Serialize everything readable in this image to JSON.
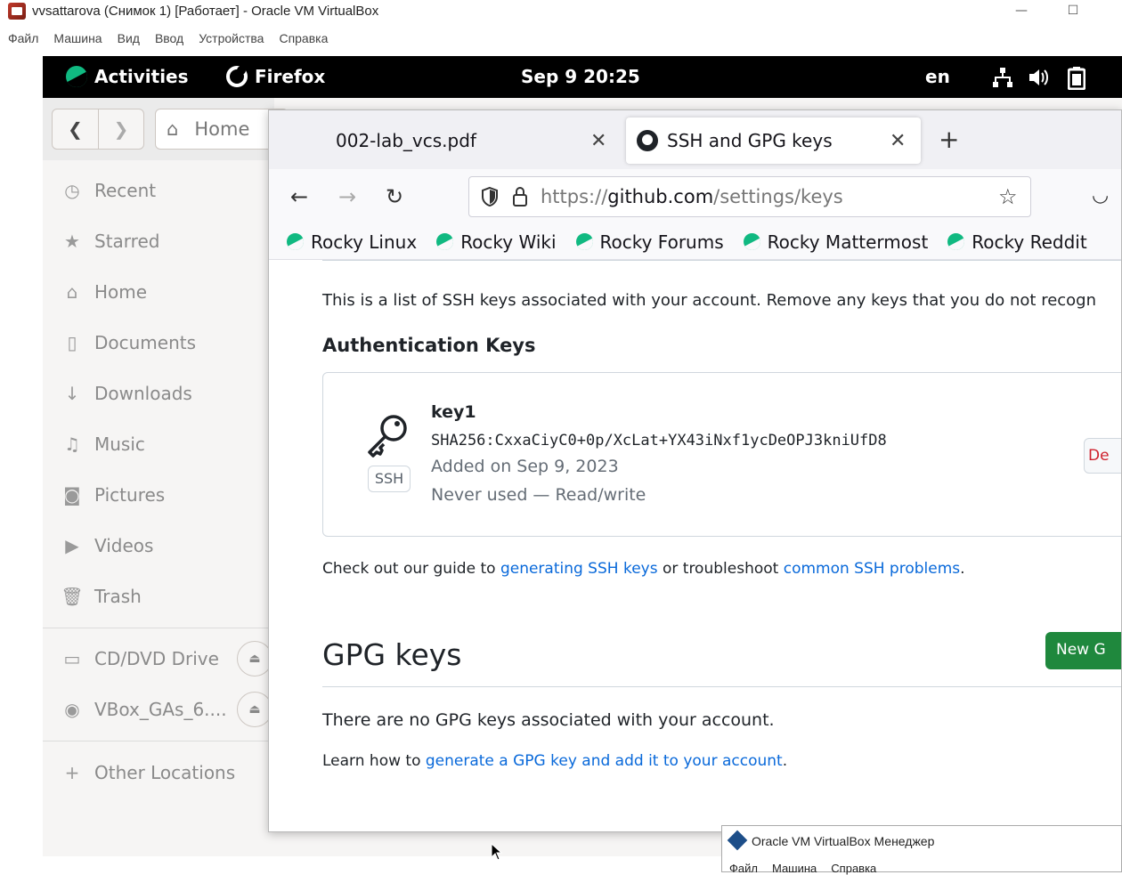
{
  "host": {
    "title": "vvsattarova (Снимок 1) [Работает] - Oracle VM VirtualBox",
    "menu": [
      "Файл",
      "Машина",
      "Вид",
      "Ввод",
      "Устройства",
      "Справка"
    ]
  },
  "topbar": {
    "activities": "Activities",
    "app": "Firefox",
    "clock": "Sep 9  20:25",
    "lang": "en"
  },
  "files": {
    "path_home": "Home",
    "sidebar": [
      "Recent",
      "Starred",
      "Home",
      "Documents",
      "Downloads",
      "Music",
      "Pictures",
      "Videos",
      "Trash"
    ],
    "devices": [
      "CD/DVD Drive",
      "VBox_GAs_6...."
    ],
    "other": "Other Locations"
  },
  "firefox": {
    "tabs": [
      {
        "label": "002-lab_vcs.pdf"
      },
      {
        "label": "SSH and GPG keys"
      }
    ],
    "url_prefix": "https://",
    "url_host": "github.com",
    "url_path": "/settings/keys",
    "bookmarks": [
      "Rocky Linux",
      "Rocky Wiki",
      "Rocky Forums",
      "Rocky Mattermost",
      "Rocky Reddit"
    ]
  },
  "page": {
    "intro": "This is a list of SSH keys associated with your account. Remove any keys that you do not recogn",
    "auth_heading": "Authentication Keys",
    "key": {
      "title": "key1",
      "fingerprint": "SHA256:CxxaCiyC0+0p/XcLat+YX43iNxf1ycDeOPJ3kniUfD8",
      "added": "Added on Sep 9, 2023",
      "used": "Never used — Read/write",
      "badge": "SSH",
      "delete": "De"
    },
    "guide_pre": "Check out our guide to ",
    "guide_link1": "generating SSH keys",
    "guide_mid": " or troubleshoot ",
    "guide_link2": "common SSH problems",
    "guide_end": ".",
    "gpg_heading": "GPG keys",
    "new_gpg": "New G",
    "gpg_none": "There are no GPG keys associated with your account.",
    "gpg_learn_pre": "Learn how to ",
    "gpg_learn_link": "generate a GPG key and add it to your account",
    "gpg_learn_end": "."
  },
  "manager": {
    "title": "Oracle VM VirtualBox Менеджер",
    "menu": [
      "Файл",
      "Машина",
      "Справка"
    ]
  }
}
